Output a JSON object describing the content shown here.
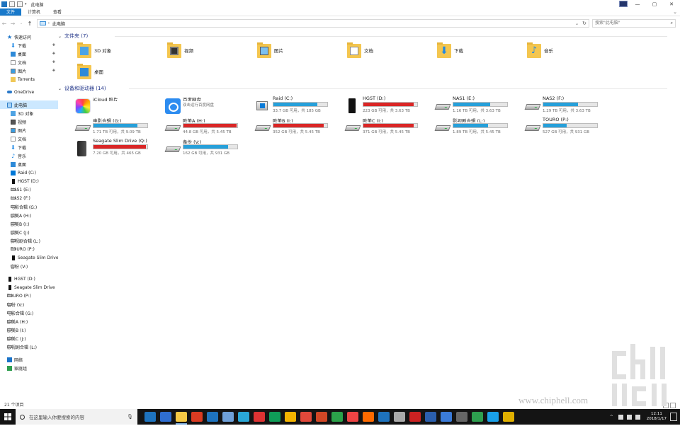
{
  "window": {
    "title": "此电脑"
  },
  "ribbon": {
    "tabs": [
      "文件",
      "计算机",
      "查看"
    ]
  },
  "address": {
    "location": "此电脑",
    "search_placeholder": "搜索\"此电脑\""
  },
  "sidebar": {
    "items": [
      {
        "label": "快速访问",
        "icon": "star-icon",
        "indent": 0,
        "pinned": false,
        "selected": false
      },
      {
        "label": "下载",
        "icon": "download-icon",
        "indent": 1,
        "pinned": true,
        "selected": false
      },
      {
        "label": "桌面",
        "icon": "desktop-icon",
        "indent": 1,
        "pinned": true,
        "selected": false
      },
      {
        "label": "文档",
        "icon": "document-icon",
        "indent": 1,
        "pinned": true,
        "selected": false
      },
      {
        "label": "图片",
        "icon": "picture-icon",
        "indent": 1,
        "pinned": true,
        "selected": false
      },
      {
        "label": "Torrents",
        "icon": "folder-icon",
        "indent": 1,
        "pinned": false,
        "selected": false
      },
      {
        "label": "OneDrive",
        "icon": "cloud-icon",
        "indent": 0,
        "pinned": false,
        "selected": false
      },
      {
        "label": "此电脑",
        "icon": "pc-icon",
        "indent": 0,
        "pinned": false,
        "selected": true
      },
      {
        "label": "3D 对象",
        "icon": "cube-icon",
        "indent": 1,
        "pinned": false,
        "selected": false
      },
      {
        "label": "视频",
        "icon": "video-icon",
        "indent": 1,
        "pinned": false,
        "selected": false
      },
      {
        "label": "图片",
        "icon": "picture-icon",
        "indent": 1,
        "pinned": false,
        "selected": false
      },
      {
        "label": "文档",
        "icon": "document-icon",
        "indent": 1,
        "pinned": false,
        "selected": false
      },
      {
        "label": "下载",
        "icon": "download-icon",
        "indent": 1,
        "pinned": false,
        "selected": false
      },
      {
        "label": "音乐",
        "icon": "music-icon",
        "indent": 1,
        "pinned": false,
        "selected": false
      },
      {
        "label": "桌面",
        "icon": "desktop-icon",
        "indent": 1,
        "pinned": false,
        "selected": false
      },
      {
        "label": "Raid (C:)",
        "icon": "windows-drive-icon",
        "indent": 1,
        "pinned": false,
        "selected": false
      },
      {
        "label": "HGST (D:)",
        "icon": "external-drive-icon",
        "indent": 1,
        "pinned": false,
        "selected": false
      },
      {
        "label": "NAS1 (E:)",
        "icon": "drive-icon",
        "indent": 1,
        "pinned": false,
        "selected": false
      },
      {
        "label": "NAS2 (F:)",
        "icon": "drive-icon",
        "indent": 1,
        "pinned": false,
        "selected": false
      },
      {
        "label": "电影合辑 (G:)",
        "icon": "drive-icon",
        "indent": 1,
        "pinned": false,
        "selected": false
      },
      {
        "label": "欧美A (H:)",
        "icon": "drive-icon",
        "indent": 1,
        "pinned": false,
        "selected": false
      },
      {
        "label": "欧美B (I:)",
        "icon": "drive-icon",
        "indent": 1,
        "pinned": false,
        "selected": false
      },
      {
        "label": "欧美C (J:)",
        "icon": "drive-icon",
        "indent": 1,
        "pinned": false,
        "selected": false
      },
      {
        "label": "影视剧合辑 (L:)",
        "icon": "drive-icon",
        "indent": 1,
        "pinned": false,
        "selected": false
      },
      {
        "label": "TOURO (P:)",
        "icon": "drive-icon",
        "indent": 1,
        "pinned": false,
        "selected": false
      },
      {
        "label": "Seagate Slim Drive",
        "icon": "external-drive-icon",
        "indent": 1,
        "pinned": false,
        "selected": false
      },
      {
        "label": "备份 (V:)",
        "icon": "drive-icon",
        "indent": 1,
        "pinned": false,
        "selected": false
      },
      {
        "label": "HGST (D:)",
        "icon": "external-drive-icon",
        "indent": 0,
        "pinned": false,
        "selected": false
      },
      {
        "label": "Seagate Slim Drive",
        "icon": "external-drive-icon",
        "indent": 0,
        "pinned": false,
        "selected": false
      },
      {
        "label": "TOURO (P:)",
        "icon": "drive-icon",
        "indent": 0,
        "pinned": false,
        "selected": false
      },
      {
        "label": "备份 (V:)",
        "icon": "drive-icon",
        "indent": 0,
        "pinned": false,
        "selected": false
      },
      {
        "label": "电影合辑 (G:)",
        "icon": "drive-icon",
        "indent": 0,
        "pinned": false,
        "selected": false
      },
      {
        "label": "欧美A (H:)",
        "icon": "drive-icon",
        "indent": 0,
        "pinned": false,
        "selected": false
      },
      {
        "label": "欧美B (I:)",
        "icon": "drive-icon",
        "indent": 0,
        "pinned": false,
        "selected": false
      },
      {
        "label": "欧美C (J:)",
        "icon": "drive-icon",
        "indent": 0,
        "pinned": false,
        "selected": false
      },
      {
        "label": "影视剧合辑 (L:)",
        "icon": "drive-icon",
        "indent": 0,
        "pinned": false,
        "selected": false
      },
      {
        "label": "网络",
        "icon": "network-icon",
        "indent": 0,
        "pinned": false,
        "selected": false
      },
      {
        "label": "家庭组",
        "icon": "homegroup-icon",
        "indent": 0,
        "pinned": false,
        "selected": false
      }
    ]
  },
  "folders_section": {
    "header": "文件夹 (7)",
    "items": [
      {
        "label": "3D 对象",
        "icon": "cube-folder-icon"
      },
      {
        "label": "视频",
        "icon": "video-folder-icon"
      },
      {
        "label": "图片",
        "icon": "picture-folder-icon"
      },
      {
        "label": "文档",
        "icon": "document-folder-icon"
      },
      {
        "label": "下载",
        "icon": "download-folder-icon"
      },
      {
        "label": "音乐",
        "icon": "music-folder-icon"
      },
      {
        "label": "桌面",
        "icon": "desktop-folder-icon"
      }
    ]
  },
  "drives_section": {
    "header": "设备和驱动器 (14)",
    "items": [
      {
        "name": "iCloud 照片",
        "kind": "icloud",
        "sub": ""
      },
      {
        "name": "百度网盘",
        "kind": "baidu",
        "sub": "双击运行百度网盘"
      },
      {
        "name": "Raid (C:)",
        "kind": "windows",
        "used_fraction": 0.82,
        "full": false,
        "size": "33.7 GB 可用，共 185 GB"
      },
      {
        "name": "HGST (D:)",
        "kind": "black",
        "used_fraction": 0.94,
        "full": true,
        "size": "223 GB 可用，共 3.63 TB"
      },
      {
        "name": "NAS1 (E:)",
        "kind": "hdd",
        "used_fraction": 0.68,
        "full": false,
        "size": "1.16 TB 可用，共 3.63 TB"
      },
      {
        "name": "NAS2 (F:)",
        "kind": "hdd",
        "used_fraction": 0.65,
        "full": false,
        "size": "1.29 TB 可用，共 3.63 TB"
      },
      {
        "name": "电影合辑 (G:)",
        "kind": "hdd",
        "used_fraction": 0.81,
        "full": false,
        "size": "1.71 TB 可用，共 9.09 TB"
      },
      {
        "name": "欧美A (H:)",
        "kind": "hdd",
        "used_fraction": 0.99,
        "full": true,
        "size": "44.8 GB 可用，共 5.45 TB"
      },
      {
        "name": "欧美B (I:)",
        "kind": "hdd",
        "used_fraction": 0.94,
        "full": true,
        "size": "352 GB 可用，共 5.45 TB"
      },
      {
        "name": "欧美C (J:)",
        "kind": "hdd",
        "used_fraction": 0.93,
        "full": true,
        "size": "371 GB 可用，共 5.45 TB"
      },
      {
        "name": "影视剧合辑 (L:)",
        "kind": "hdd",
        "used_fraction": 0.65,
        "full": false,
        "size": "1.89 TB 可用，共 5.45 TB"
      },
      {
        "name": "TOURO (P:)",
        "kind": "hdd",
        "used_fraction": 0.43,
        "full": false,
        "size": "527 GB 可用，共 931 GB"
      },
      {
        "name": "Seagate Slim Drive (Q:)",
        "kind": "seagate",
        "used_fraction": 0.98,
        "full": true,
        "size": "7.20 GB 可用，共 465 GB"
      },
      {
        "name": "备份 (V:)",
        "kind": "hdd",
        "used_fraction": 0.83,
        "full": false,
        "size": "162 GB 可用，共 931 GB"
      }
    ]
  },
  "statusbar": {
    "count": "21 个项目"
  },
  "taskbar": {
    "search_placeholder": "在这里输入你要搜索的内容",
    "time": "12:11",
    "date": "2018/1/17",
    "app_colors": [
      "#1e73be",
      "#2f6ed1",
      "#f6c945",
      "#da3b22",
      "#1e73be",
      "#6ea0d8",
      "#2aa7d6",
      "#d33",
      "#0f9d58",
      "#f4b400",
      "#e0483a",
      "#d24726",
      "#2ba24a",
      "#e44",
      "#ff6a00",
      "#1e73be",
      "#aaa",
      "#cc2222",
      "#2b5fad",
      "#3b7bd8",
      "#666",
      "#2e9e4f",
      "#1aa0e8",
      "#e0b000"
    ]
  },
  "watermark": {
    "text": "www.chiphell.com"
  },
  "colors": {
    "accent": "#1979ca",
    "bar_normal": "#26a0da",
    "bar_full": "#da2626",
    "selection": "#cce8ff"
  }
}
